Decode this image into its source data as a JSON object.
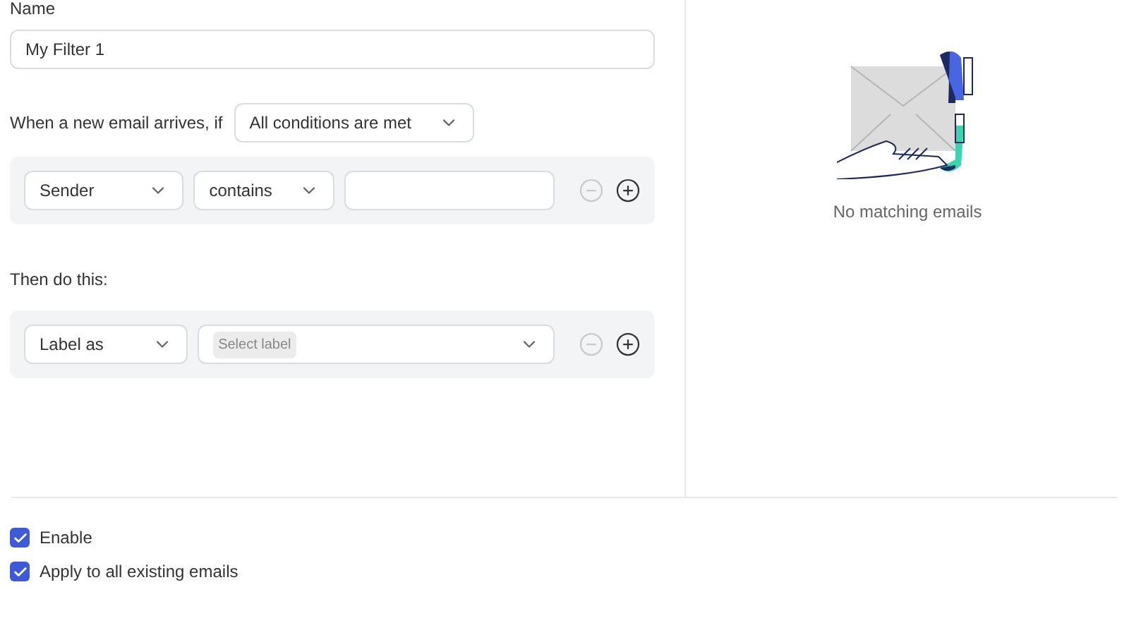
{
  "name_field": {
    "label": "Name",
    "value": "My Filter 1"
  },
  "condition": {
    "prefix": "When a new email arrives, if",
    "match": "All conditions are met"
  },
  "rules": [
    {
      "field": "Sender",
      "operator": "contains"
    }
  ],
  "action_heading": "Then do this:",
  "actions": [
    {
      "action": "Label as",
      "placeholder": "Select label"
    }
  ],
  "preview": {
    "message": "No matching emails"
  },
  "options": [
    {
      "label": "Enable",
      "checked": true
    },
    {
      "label": "Apply to all existing emails",
      "checked": true
    }
  ]
}
